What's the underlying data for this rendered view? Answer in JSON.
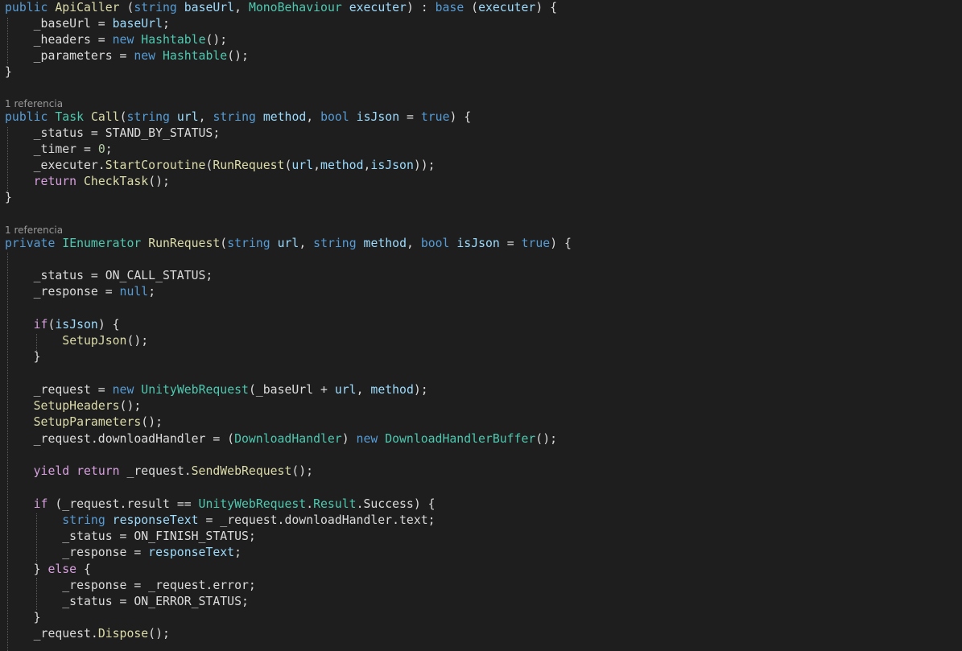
{
  "codelens": {
    "call_refs": "1 referencia",
    "run_request_refs": "1 referencia"
  },
  "lines": [
    [
      [
        "kw",
        "public"
      ],
      [
        "txt",
        " "
      ],
      [
        "meth",
        "ApiCaller"
      ],
      [
        "txt",
        " ("
      ],
      [
        "kw",
        "string"
      ],
      [
        "txt",
        " "
      ],
      [
        "prm",
        "baseUrl"
      ],
      [
        "txt",
        ", "
      ],
      [
        "type",
        "MonoBehaviour"
      ],
      [
        "txt",
        " "
      ],
      [
        "prm",
        "executer"
      ],
      [
        "txt",
        ") : "
      ],
      [
        "kw",
        "base"
      ],
      [
        "txt",
        " ("
      ],
      [
        "prm",
        "executer"
      ],
      [
        "txt",
        ") {"
      ]
    ],
    [
      [
        "txt",
        "    _baseUrl = "
      ],
      [
        "prm",
        "baseUrl"
      ],
      [
        "txt",
        ";"
      ]
    ],
    [
      [
        "txt",
        "    _headers = "
      ],
      [
        "kw",
        "new"
      ],
      [
        "txt",
        " "
      ],
      [
        "type",
        "Hashtable"
      ],
      [
        "txt",
        "();"
      ]
    ],
    [
      [
        "txt",
        "    _parameters = "
      ],
      [
        "kw",
        "new"
      ],
      [
        "txt",
        " "
      ],
      [
        "type",
        "Hashtable"
      ],
      [
        "txt",
        "();"
      ]
    ],
    [
      [
        "txt",
        "}"
      ]
    ],
    [],
    [
      [
        "kw",
        "public"
      ],
      [
        "txt",
        " "
      ],
      [
        "type",
        "Task"
      ],
      [
        "txt",
        " "
      ],
      [
        "meth",
        "Call"
      ],
      [
        "txt",
        "("
      ],
      [
        "kw",
        "string"
      ],
      [
        "txt",
        " "
      ],
      [
        "prm",
        "url"
      ],
      [
        "txt",
        ", "
      ],
      [
        "kw",
        "string"
      ],
      [
        "txt",
        " "
      ],
      [
        "prm",
        "method"
      ],
      [
        "txt",
        ", "
      ],
      [
        "kw",
        "bool"
      ],
      [
        "txt",
        " "
      ],
      [
        "prm",
        "isJson"
      ],
      [
        "txt",
        " = "
      ],
      [
        "kw",
        "true"
      ],
      [
        "txt",
        ") {"
      ]
    ],
    [
      [
        "txt",
        "    _status = STAND_BY_STATUS;"
      ]
    ],
    [
      [
        "txt",
        "    _timer = "
      ],
      [
        "num",
        "0"
      ],
      [
        "txt",
        ";"
      ]
    ],
    [
      [
        "txt",
        "    _executer."
      ],
      [
        "meth",
        "StartCoroutine"
      ],
      [
        "txt",
        "("
      ],
      [
        "meth",
        "RunRequest"
      ],
      [
        "txt",
        "("
      ],
      [
        "prm",
        "url"
      ],
      [
        "txt",
        ","
      ],
      [
        "prm",
        "method"
      ],
      [
        "txt",
        ","
      ],
      [
        "prm",
        "isJson"
      ],
      [
        "txt",
        "));"
      ]
    ],
    [
      [
        "txt",
        "    "
      ],
      [
        "ctl",
        "return"
      ],
      [
        "txt",
        " "
      ],
      [
        "meth",
        "CheckTask"
      ],
      [
        "txt",
        "();"
      ]
    ],
    [
      [
        "txt",
        "}"
      ]
    ],
    [],
    [
      [
        "kw",
        "private"
      ],
      [
        "txt",
        " "
      ],
      [
        "type",
        "IEnumerator"
      ],
      [
        "txt",
        " "
      ],
      [
        "meth",
        "RunRequest"
      ],
      [
        "txt",
        "("
      ],
      [
        "kw",
        "string"
      ],
      [
        "txt",
        " "
      ],
      [
        "prm",
        "url"
      ],
      [
        "txt",
        ", "
      ],
      [
        "kw",
        "string"
      ],
      [
        "txt",
        " "
      ],
      [
        "prm",
        "method"
      ],
      [
        "txt",
        ", "
      ],
      [
        "kw",
        "bool"
      ],
      [
        "txt",
        " "
      ],
      [
        "prm",
        "isJson"
      ],
      [
        "txt",
        " = "
      ],
      [
        "kw",
        "true"
      ],
      [
        "txt",
        ") {"
      ]
    ],
    [],
    [
      [
        "txt",
        "    _status = ON_CALL_STATUS;"
      ]
    ],
    [
      [
        "txt",
        "    _response = "
      ],
      [
        "kw",
        "null"
      ],
      [
        "txt",
        ";"
      ]
    ],
    [],
    [
      [
        "txt",
        "    "
      ],
      [
        "ctl",
        "if"
      ],
      [
        "txt",
        "("
      ],
      [
        "prm",
        "isJson"
      ],
      [
        "txt",
        ") {"
      ]
    ],
    [
      [
        "txt",
        "        "
      ],
      [
        "meth",
        "SetupJson"
      ],
      [
        "txt",
        "();"
      ]
    ],
    [
      [
        "txt",
        "    }"
      ]
    ],
    [],
    [
      [
        "txt",
        "    _request = "
      ],
      [
        "kw",
        "new"
      ],
      [
        "txt",
        " "
      ],
      [
        "type",
        "UnityWebRequest"
      ],
      [
        "txt",
        "(_baseUrl + "
      ],
      [
        "prm",
        "url"
      ],
      [
        "txt",
        ", "
      ],
      [
        "prm",
        "method"
      ],
      [
        "txt",
        ");"
      ]
    ],
    [
      [
        "txt",
        "    "
      ],
      [
        "meth",
        "SetupHeaders"
      ],
      [
        "txt",
        "();"
      ]
    ],
    [
      [
        "txt",
        "    "
      ],
      [
        "meth",
        "SetupParameters"
      ],
      [
        "txt",
        "();"
      ]
    ],
    [
      [
        "txt",
        "    _request.downloadHandler = ("
      ],
      [
        "type",
        "DownloadHandler"
      ],
      [
        "txt",
        ") "
      ],
      [
        "kw",
        "new"
      ],
      [
        "txt",
        " "
      ],
      [
        "type",
        "DownloadHandlerBuffer"
      ],
      [
        "txt",
        "();"
      ]
    ],
    [],
    [
      [
        "txt",
        "    "
      ],
      [
        "ctl",
        "yield return"
      ],
      [
        "txt",
        " _request."
      ],
      [
        "meth",
        "SendWebRequest"
      ],
      [
        "txt",
        "();"
      ]
    ],
    [],
    [
      [
        "txt",
        "    "
      ],
      [
        "ctl",
        "if"
      ],
      [
        "txt",
        " (_request.result == "
      ],
      [
        "type",
        "UnityWebRequest"
      ],
      [
        "txt",
        "."
      ],
      [
        "type",
        "Result"
      ],
      [
        "txt",
        ".Success) {"
      ]
    ],
    [
      [
        "txt",
        "        "
      ],
      [
        "kw",
        "string"
      ],
      [
        "txt",
        " "
      ],
      [
        "prm",
        "responseText"
      ],
      [
        "txt",
        " = _request.downloadHandler.text;"
      ]
    ],
    [
      [
        "txt",
        "        _status = ON_FINISH_STATUS;"
      ]
    ],
    [
      [
        "txt",
        "        _response = "
      ],
      [
        "prm",
        "responseText"
      ],
      [
        "txt",
        ";"
      ]
    ],
    [
      [
        "txt",
        "    } "
      ],
      [
        "ctl",
        "else"
      ],
      [
        "txt",
        " {"
      ]
    ],
    [
      [
        "txt",
        "        _response = _request.error;"
      ]
    ],
    [
      [
        "txt",
        "        _status = ON_ERROR_STATUS;"
      ]
    ],
    [
      [
        "txt",
        "    }"
      ]
    ],
    [
      [
        "txt",
        "    _request."
      ],
      [
        "meth",
        "Dispose"
      ],
      [
        "txt",
        "();"
      ]
    ]
  ]
}
